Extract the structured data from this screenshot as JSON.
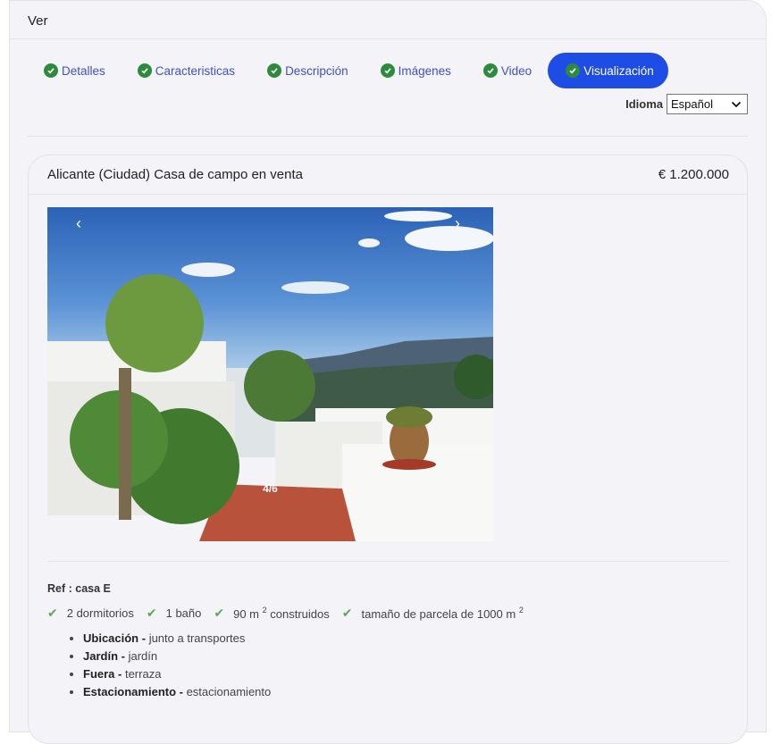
{
  "header": {
    "title": "Ver"
  },
  "tabs": [
    {
      "label": "Detalles"
    },
    {
      "label": "Caracteristicas"
    },
    {
      "label": "Descripción"
    },
    {
      "label": "Imágenes"
    },
    {
      "label": "Video"
    },
    {
      "label": "Visualización",
      "active": true
    }
  ],
  "language": {
    "label": "Idioma",
    "selected": "Español"
  },
  "property": {
    "title": "Alicante (Ciudad) Casa de campo en venta",
    "price": "€ 1.200.000",
    "gallery": {
      "counter": "4/6",
      "prev_icon": "chevron-left-icon",
      "next_icon": "chevron-right-icon"
    },
    "ref_label": "Ref : ",
    "ref_value": "casa E",
    "features": {
      "bedrooms": "2 dormitorios",
      "bathrooms": "1 baño",
      "built_pre": "90 m",
      "built_sup": "2",
      "built_post": " construidos",
      "plot_pre": "tamaño de parcela de 1000 m",
      "plot_sup": "2"
    },
    "details": [
      {
        "key": "Ubicación - ",
        "value": "junto a transportes"
      },
      {
        "key": "Jardín - ",
        "value": "jardín"
      },
      {
        "key": "Fuera - ",
        "value": "terraza"
      },
      {
        "key": "Estacionamiento - ",
        "value": "estacionamiento"
      }
    ]
  },
  "colors": {
    "accent": "#1e4de6",
    "link": "#3f51c9",
    "check": "#2e8b3d",
    "tick": "#5ea75b",
    "panel": "#f4f3f8"
  }
}
